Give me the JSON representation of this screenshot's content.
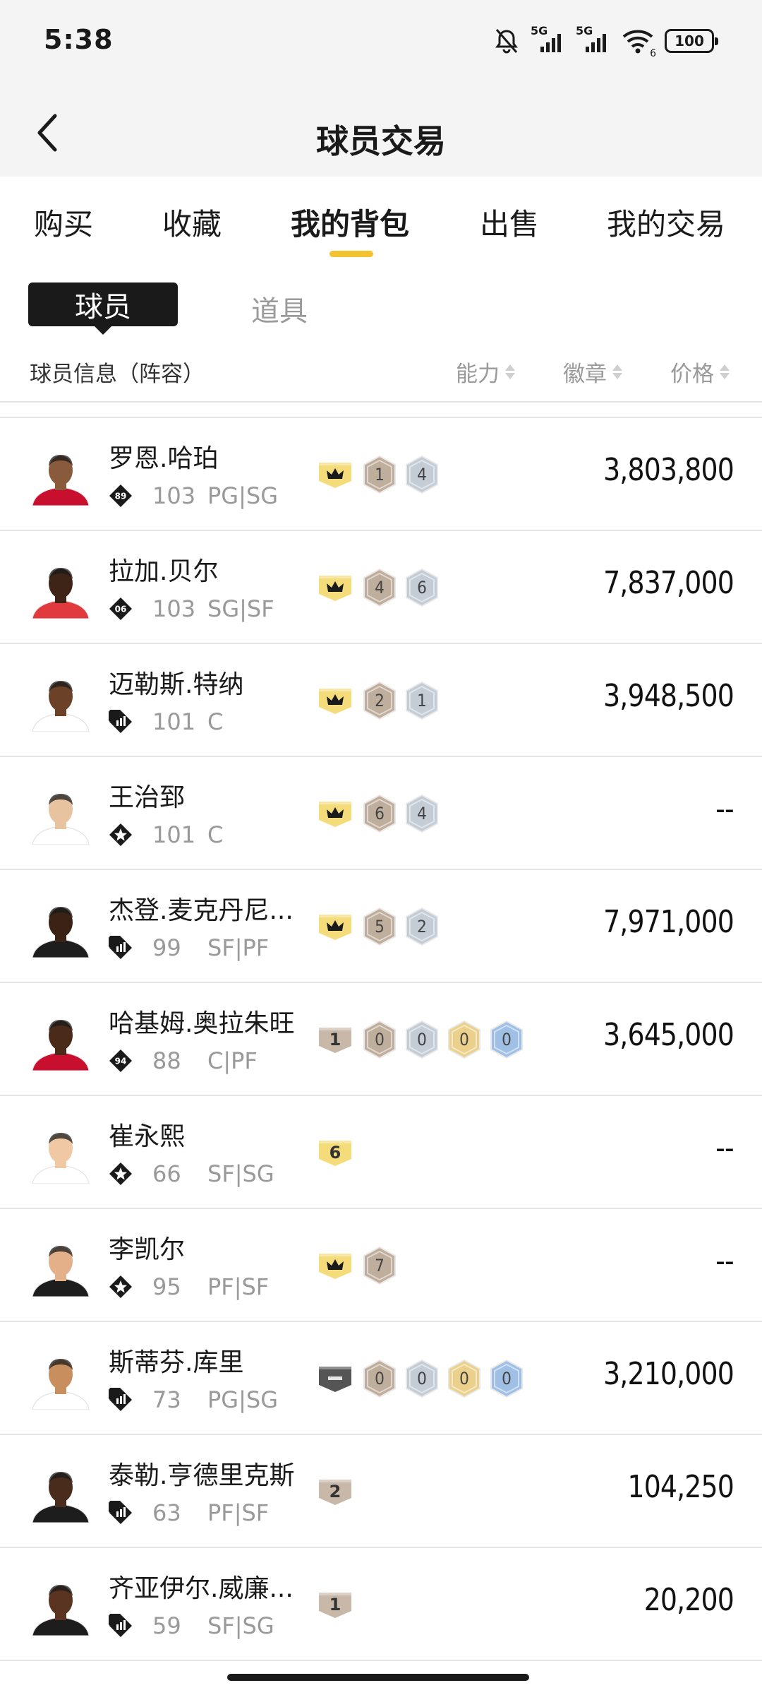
{
  "status_bar": {
    "time": "5:38",
    "network_1": "5G",
    "network_2": "5G",
    "wifi_level": "6",
    "battery": "100"
  },
  "nav": {
    "title": "球员交易"
  },
  "tabs": [
    {
      "label": "购买",
      "active": false
    },
    {
      "label": "收藏",
      "active": false
    },
    {
      "label": "我的背包",
      "active": true
    },
    {
      "label": "出售",
      "active": false
    },
    {
      "label": "我的交易",
      "active": false
    }
  ],
  "sub_tabs": {
    "players": "球员",
    "items": "道具"
  },
  "columns": {
    "info": "球员信息（阵容）",
    "ability": "能力",
    "badges": "徽章",
    "price": "价格"
  },
  "players": [
    {
      "name": "罗恩.哈珀",
      "tier": "89",
      "rating": "103",
      "position": "PG|SG",
      "card": "crown",
      "badges": [
        "1",
        "4"
      ],
      "price": "3,803,800"
    },
    {
      "name": "拉加.贝尔",
      "tier": "06",
      "rating": "103",
      "position": "SG|SF",
      "card": "crown",
      "badges": [
        "4",
        "6"
      ],
      "price": "7,837,000"
    },
    {
      "name": "迈勒斯.特纳",
      "tier": "bars",
      "rating": "101",
      "position": "C",
      "card": "crown",
      "badges": [
        "2",
        "1"
      ],
      "price": "3,948,500"
    },
    {
      "name": "王治郅",
      "tier": "star",
      "rating": "101",
      "position": "C",
      "card": "crown",
      "badges": [
        "6",
        "4"
      ],
      "price": "--"
    },
    {
      "name": "杰登.麦克丹尼...",
      "tier": "bars",
      "rating": "99",
      "position": "SF|PF",
      "card": "crown",
      "badges": [
        "5",
        "2"
      ],
      "price": "7,971,000"
    },
    {
      "name": "哈基姆.奥拉朱旺",
      "tier": "94",
      "rating": "88",
      "position": "C|PF",
      "card": "1",
      "badges": [
        "0",
        "0",
        "0",
        "0"
      ],
      "price": "3,645,000"
    },
    {
      "name": "崔永熙",
      "tier": "star",
      "rating": "66",
      "position": "SF|SG",
      "card": "6",
      "badges": [],
      "price": "--"
    },
    {
      "name": "李凯尔",
      "tier": "star",
      "rating": "95",
      "position": "PF|SF",
      "card": "crown",
      "badges": [
        "7"
      ],
      "price": "--"
    },
    {
      "name": "斯蒂芬.库里",
      "tier": "bars",
      "rating": "73",
      "position": "PG|SG",
      "card": "dash",
      "badges": [
        "0",
        "0",
        "0",
        "0"
      ],
      "price": "3,210,000"
    },
    {
      "name": "泰勒.亨德里克斯",
      "tier": "bars",
      "rating": "63",
      "position": "PF|SF",
      "card": "2",
      "badges": [],
      "price": "104,250"
    },
    {
      "name": "齐亚伊尔.威廉...",
      "tier": "bars",
      "rating": "59",
      "position": "SF|SG",
      "card": "1",
      "badges": [],
      "price": "20,200"
    }
  ],
  "colors": {
    "accent": "#f2c230",
    "crown_card": "#f5dc7a",
    "bronze_card": "#c9b8a8",
    "dark_card": "#555555",
    "bronze_badge": "#bfae9c",
    "silver_badge": "#c4ccd6",
    "gold_badge": "#ead08a",
    "blue_badge": "#9fc0e4"
  }
}
